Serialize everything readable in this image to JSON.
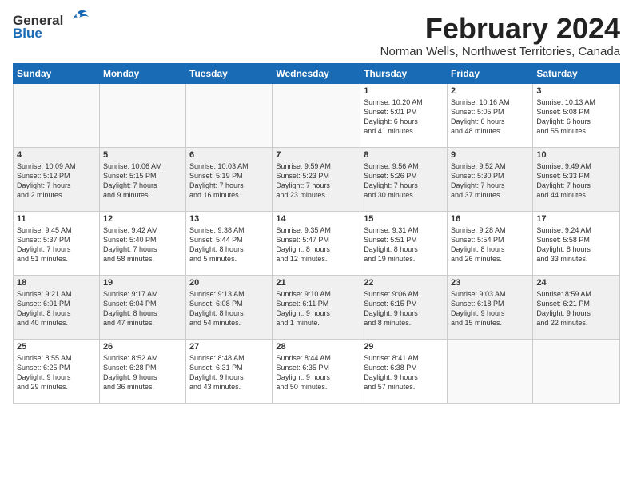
{
  "header": {
    "logo_line1": "General",
    "logo_line2": "Blue",
    "month_title": "February 2024",
    "location": "Norman Wells, Northwest Territories, Canada"
  },
  "days_of_week": [
    "Sunday",
    "Monday",
    "Tuesday",
    "Wednesday",
    "Thursday",
    "Friday",
    "Saturday"
  ],
  "weeks": [
    [
      {
        "day": "",
        "content": ""
      },
      {
        "day": "",
        "content": ""
      },
      {
        "day": "",
        "content": ""
      },
      {
        "day": "",
        "content": ""
      },
      {
        "day": "1",
        "content": "Sunrise: 10:20 AM\nSunset: 5:01 PM\nDaylight: 6 hours\nand 41 minutes."
      },
      {
        "day": "2",
        "content": "Sunrise: 10:16 AM\nSunset: 5:05 PM\nDaylight: 6 hours\nand 48 minutes."
      },
      {
        "day": "3",
        "content": "Sunrise: 10:13 AM\nSunset: 5:08 PM\nDaylight: 6 hours\nand 55 minutes."
      }
    ],
    [
      {
        "day": "4",
        "content": "Sunrise: 10:09 AM\nSunset: 5:12 PM\nDaylight: 7 hours\nand 2 minutes."
      },
      {
        "day": "5",
        "content": "Sunrise: 10:06 AM\nSunset: 5:15 PM\nDaylight: 7 hours\nand 9 minutes."
      },
      {
        "day": "6",
        "content": "Sunrise: 10:03 AM\nSunset: 5:19 PM\nDaylight: 7 hours\nand 16 minutes."
      },
      {
        "day": "7",
        "content": "Sunrise: 9:59 AM\nSunset: 5:23 PM\nDaylight: 7 hours\nand 23 minutes."
      },
      {
        "day": "8",
        "content": "Sunrise: 9:56 AM\nSunset: 5:26 PM\nDaylight: 7 hours\nand 30 minutes."
      },
      {
        "day": "9",
        "content": "Sunrise: 9:52 AM\nSunset: 5:30 PM\nDaylight: 7 hours\nand 37 minutes."
      },
      {
        "day": "10",
        "content": "Sunrise: 9:49 AM\nSunset: 5:33 PM\nDaylight: 7 hours\nand 44 minutes."
      }
    ],
    [
      {
        "day": "11",
        "content": "Sunrise: 9:45 AM\nSunset: 5:37 PM\nDaylight: 7 hours\nand 51 minutes."
      },
      {
        "day": "12",
        "content": "Sunrise: 9:42 AM\nSunset: 5:40 PM\nDaylight: 7 hours\nand 58 minutes."
      },
      {
        "day": "13",
        "content": "Sunrise: 9:38 AM\nSunset: 5:44 PM\nDaylight: 8 hours\nand 5 minutes."
      },
      {
        "day": "14",
        "content": "Sunrise: 9:35 AM\nSunset: 5:47 PM\nDaylight: 8 hours\nand 12 minutes."
      },
      {
        "day": "15",
        "content": "Sunrise: 9:31 AM\nSunset: 5:51 PM\nDaylight: 8 hours\nand 19 minutes."
      },
      {
        "day": "16",
        "content": "Sunrise: 9:28 AM\nSunset: 5:54 PM\nDaylight: 8 hours\nand 26 minutes."
      },
      {
        "day": "17",
        "content": "Sunrise: 9:24 AM\nSunset: 5:58 PM\nDaylight: 8 hours\nand 33 minutes."
      }
    ],
    [
      {
        "day": "18",
        "content": "Sunrise: 9:21 AM\nSunset: 6:01 PM\nDaylight: 8 hours\nand 40 minutes."
      },
      {
        "day": "19",
        "content": "Sunrise: 9:17 AM\nSunset: 6:04 PM\nDaylight: 8 hours\nand 47 minutes."
      },
      {
        "day": "20",
        "content": "Sunrise: 9:13 AM\nSunset: 6:08 PM\nDaylight: 8 hours\nand 54 minutes."
      },
      {
        "day": "21",
        "content": "Sunrise: 9:10 AM\nSunset: 6:11 PM\nDaylight: 9 hours\nand 1 minute."
      },
      {
        "day": "22",
        "content": "Sunrise: 9:06 AM\nSunset: 6:15 PM\nDaylight: 9 hours\nand 8 minutes."
      },
      {
        "day": "23",
        "content": "Sunrise: 9:03 AM\nSunset: 6:18 PM\nDaylight: 9 hours\nand 15 minutes."
      },
      {
        "day": "24",
        "content": "Sunrise: 8:59 AM\nSunset: 6:21 PM\nDaylight: 9 hours\nand 22 minutes."
      }
    ],
    [
      {
        "day": "25",
        "content": "Sunrise: 8:55 AM\nSunset: 6:25 PM\nDaylight: 9 hours\nand 29 minutes."
      },
      {
        "day": "26",
        "content": "Sunrise: 8:52 AM\nSunset: 6:28 PM\nDaylight: 9 hours\nand 36 minutes."
      },
      {
        "day": "27",
        "content": "Sunrise: 8:48 AM\nSunset: 6:31 PM\nDaylight: 9 hours\nand 43 minutes."
      },
      {
        "day": "28",
        "content": "Sunrise: 8:44 AM\nSunset: 6:35 PM\nDaylight: 9 hours\nand 50 minutes."
      },
      {
        "day": "29",
        "content": "Sunrise: 8:41 AM\nSunset: 6:38 PM\nDaylight: 9 hours\nand 57 minutes."
      },
      {
        "day": "",
        "content": ""
      },
      {
        "day": "",
        "content": ""
      }
    ]
  ]
}
